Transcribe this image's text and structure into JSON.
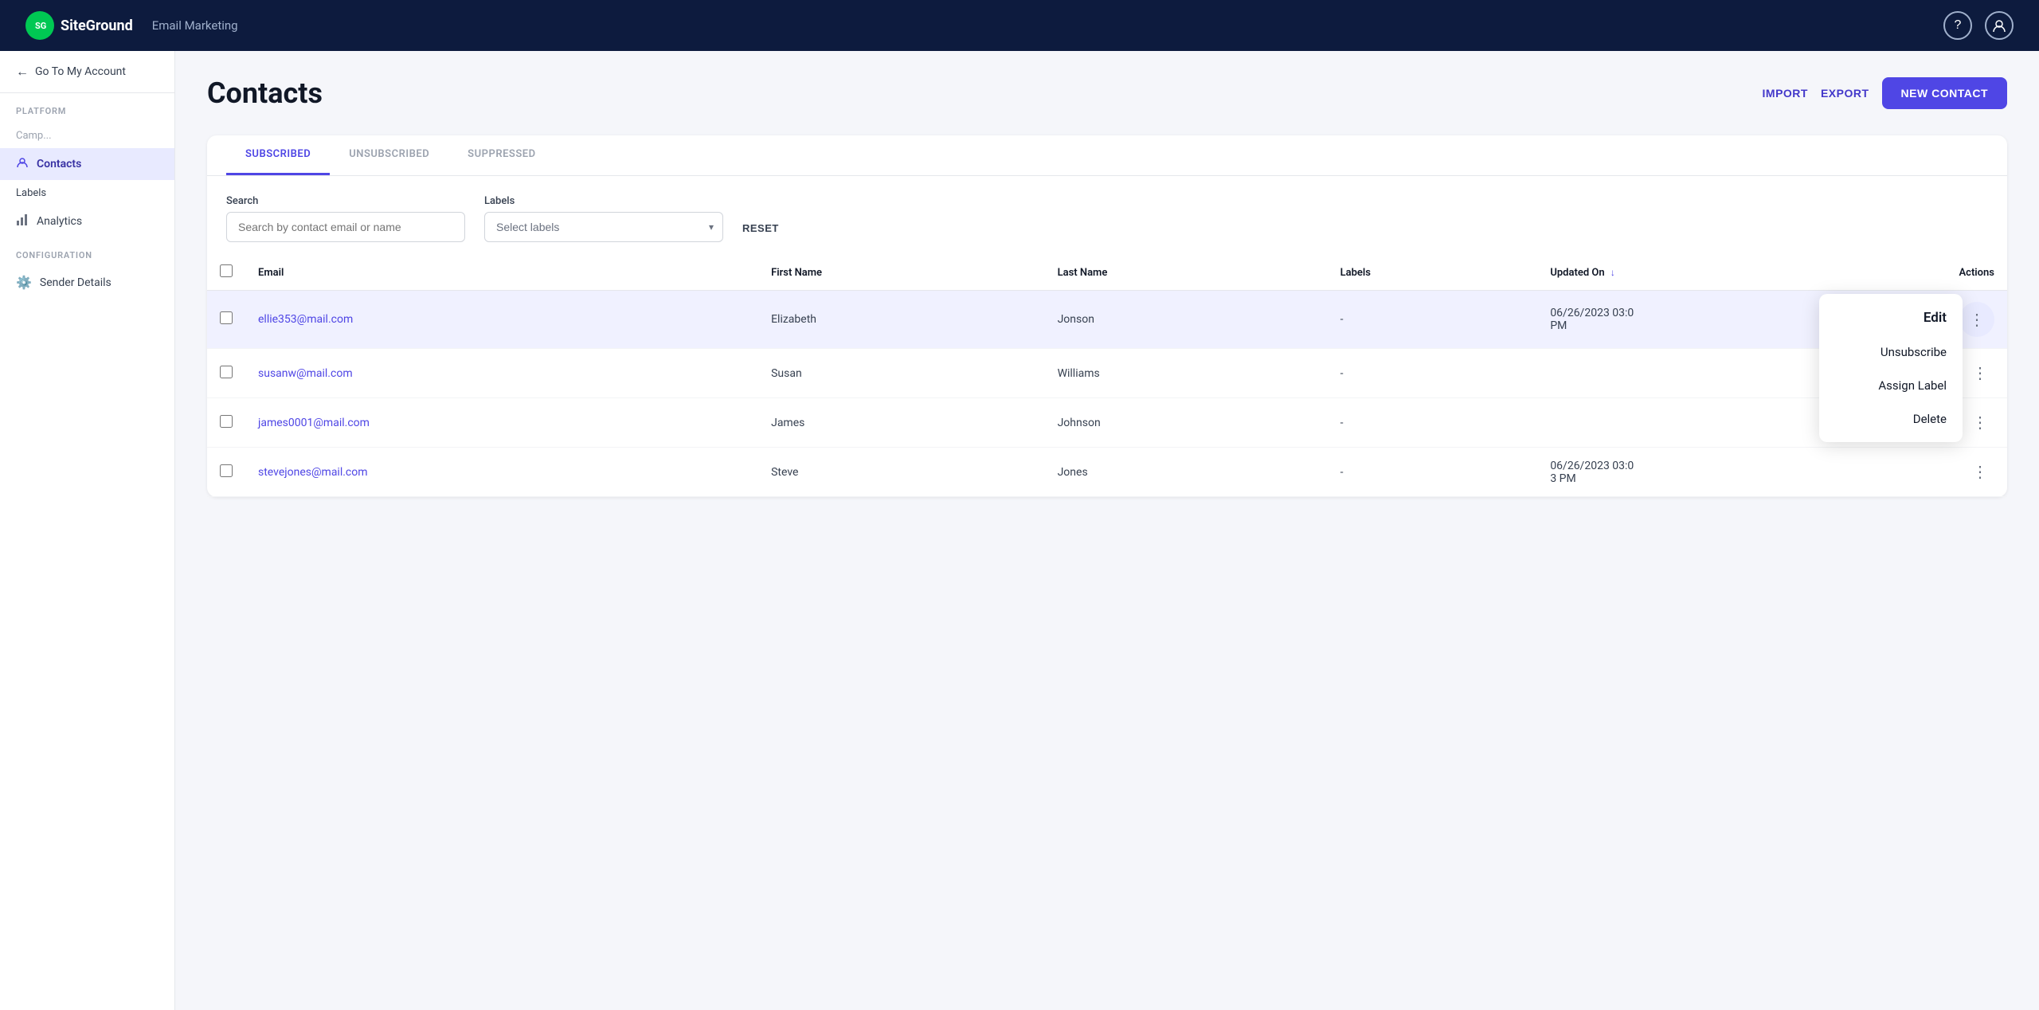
{
  "topnav": {
    "logo_text": "SiteGround",
    "app_title": "Email Marketing",
    "help_icon": "?",
    "user_icon": "👤"
  },
  "sidebar": {
    "back_label": "Go To My Account",
    "platform_label": "PLATFORM",
    "items": [
      {
        "id": "campaigns",
        "label": "Camp...",
        "icon": "📧",
        "active": false
      },
      {
        "id": "contacts",
        "label": "Contacts",
        "icon": "👤",
        "active": true
      },
      {
        "id": "labels",
        "label": "Labels",
        "icon": "🏷",
        "active": false
      },
      {
        "id": "analytics",
        "label": "Analytics",
        "icon": "📊",
        "active": false
      }
    ],
    "config_label": "CONFIGURATION",
    "config_items": [
      {
        "id": "sender-details",
        "label": "Sender Details",
        "icon": "⚙️",
        "active": false
      }
    ]
  },
  "page": {
    "title": "Contacts",
    "import_label": "IMPORT",
    "export_label": "EXPORT",
    "new_contact_label": "NEW CONTACT"
  },
  "tabs": [
    {
      "id": "subscribed",
      "label": "SUBSCRIBED",
      "active": true
    },
    {
      "id": "unsubscribed",
      "label": "UNSUBSCRIBED",
      "active": false
    },
    {
      "id": "suppressed",
      "label": "SUPPRESSED",
      "active": false
    }
  ],
  "filters": {
    "search_label": "Search",
    "search_placeholder": "Search by contact email or name",
    "labels_label": "Labels",
    "labels_placeholder": "Select labels",
    "reset_label": "RESET"
  },
  "table": {
    "columns": [
      {
        "id": "email",
        "label": "Email",
        "sortable": false
      },
      {
        "id": "first_name",
        "label": "First Name",
        "sortable": false
      },
      {
        "id": "last_name",
        "label": "Last Name",
        "sortable": false
      },
      {
        "id": "labels",
        "label": "Labels",
        "sortable": false
      },
      {
        "id": "updated_on",
        "label": "Updated On",
        "sortable": true
      },
      {
        "id": "actions",
        "label": "Actions",
        "sortable": false
      }
    ],
    "rows": [
      {
        "id": 1,
        "email": "ellie353@mail.com",
        "first_name": "Elizabeth",
        "last_name": "Jonson",
        "labels": "-",
        "updated_on": "06/26/2023 03:0­PM",
        "highlighted": true,
        "menu_open": true
      },
      {
        "id": 2,
        "email": "susanw@mail.com",
        "first_name": "Susan",
        "last_name": "Williams",
        "labels": "-",
        "updated_on": "",
        "highlighted": false,
        "menu_open": false
      },
      {
        "id": 3,
        "email": "james0001@mail.com",
        "first_name": "James",
        "last_name": "Johnson",
        "labels": "-",
        "updated_on": "",
        "highlighted": false,
        "menu_open": false
      },
      {
        "id": 4,
        "email": "stevejones@mail.com",
        "first_name": "Steve",
        "last_name": "Jones",
        "labels": "-",
        "updated_on": "06/26/2023 03:0­3 PM",
        "highlighted": false,
        "menu_open": false
      }
    ]
  },
  "context_menu": {
    "items": [
      {
        "id": "edit",
        "label": "Edit"
      },
      {
        "id": "unsubscribe",
        "label": "Unsubscribe"
      },
      {
        "id": "assign-label",
        "label": "Assign Label"
      },
      {
        "id": "delete",
        "label": "Delete"
      }
    ]
  }
}
